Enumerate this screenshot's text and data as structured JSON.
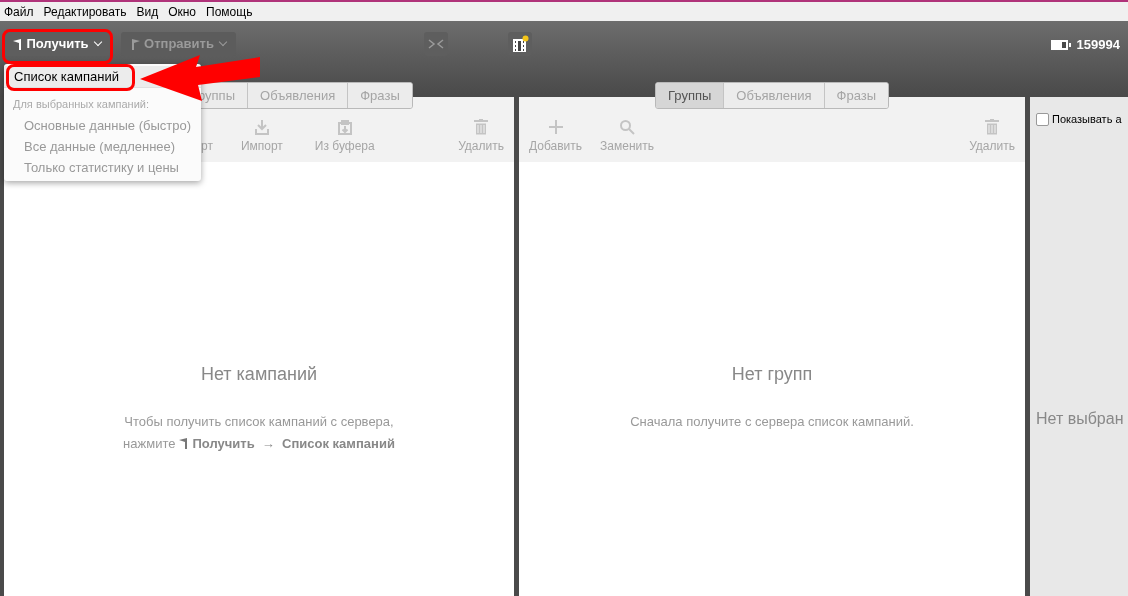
{
  "menu_bar": [
    "Файл",
    "Редактировать",
    "Вид",
    "Окно",
    "Помощь"
  ],
  "toolbar": {
    "get_button": {
      "label": "Получить",
      "highlighted": true,
      "disabled": false
    },
    "send_button": {
      "label": "Отправить",
      "disabled": true
    },
    "balance": "159994"
  },
  "dropdown": {
    "items": [
      {
        "kind": "item",
        "label": "Список кампаний",
        "selected": true,
        "highlighted": true,
        "disabled": false
      },
      {
        "kind": "header",
        "label": "Для выбранных кампаний:"
      },
      {
        "kind": "item",
        "label": "Основные данные (быстро)",
        "selected": false,
        "highlighted": false,
        "disabled": true
      },
      {
        "kind": "item",
        "label": "Все данные (медленнее)",
        "selected": false,
        "highlighted": false,
        "disabled": true
      },
      {
        "kind": "item",
        "label": "Только статистику и цены",
        "selected": false,
        "highlighted": false,
        "disabled": true
      }
    ]
  },
  "callout_arrow": true,
  "campaigns_panel": {
    "tabs": [
      {
        "label": "руппы",
        "selected": false
      },
      {
        "label": "Объявления",
        "selected": false
      },
      {
        "label": "Фразы",
        "selected": false
      }
    ],
    "actions": [
      {
        "kind": "partial",
        "label": "рт"
      },
      {
        "kind": "import",
        "label": "Импорт"
      },
      {
        "kind": "clipboard",
        "label": "Из буфера"
      },
      {
        "kind": "spacer"
      },
      {
        "kind": "delete",
        "label": "Удалить"
      }
    ],
    "empty_title": "Нет кампаний",
    "hint_line_1": "Чтобы получить список кампаний с сервера,",
    "hint_prefix": "нажмите",
    "hint_path": "**Получить**  →  **Список кампаний**"
  },
  "groups_panel": {
    "tabs": [
      {
        "label": "Группы",
        "selected": true
      },
      {
        "label": "Объявления",
        "selected": false
      },
      {
        "label": "Фразы",
        "selected": false
      }
    ],
    "actions": [
      {
        "kind": "add",
        "label": "Добавить"
      },
      {
        "kind": "search",
        "label": "Заменить"
      },
      {
        "kind": "spacer"
      },
      {
        "kind": "delete",
        "label": "Удалить"
      }
    ],
    "empty_title": "Нет групп",
    "hint": "Сначала получите с сервера список кампаний."
  },
  "details_panel": {
    "checkbox": {
      "label": "Показывать а",
      "checked": false
    },
    "empty_title": "Нет выбран"
  }
}
